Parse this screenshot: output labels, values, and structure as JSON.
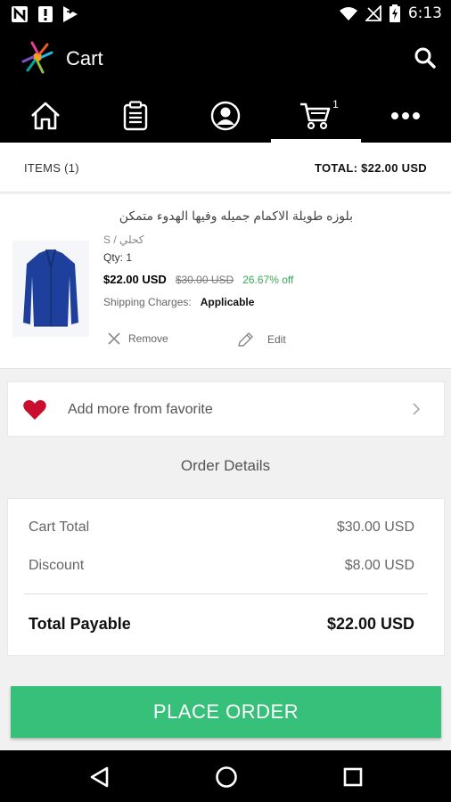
{
  "status_bar": {
    "time": "6:13",
    "icons": [
      "n-notification-icon",
      "alert-icon",
      "forward-icon",
      "wifi-icon",
      "no-signal-icon",
      "battery-charging-icon"
    ]
  },
  "app_bar": {
    "title": "Cart",
    "icons": [
      "app-logo",
      "search-icon"
    ]
  },
  "tabs": [
    {
      "name": "home",
      "icon": "home-icon"
    },
    {
      "name": "orders",
      "icon": "clipboard-icon"
    },
    {
      "name": "account",
      "icon": "user-icon"
    },
    {
      "name": "cart",
      "icon": "cart-icon",
      "badge": "1",
      "active": true
    },
    {
      "name": "more",
      "icon": "more-icon"
    }
  ],
  "cart_header": {
    "items": "ITEMS (1)",
    "total": "TOTAL: $22.00 USD"
  },
  "cart_item": {
    "name": "بلوزه طويلة الاكمام جميله وفيها الهدوء متمكن",
    "variant": "S / كحلي",
    "qty": "Qty: 1",
    "price": "$22.00 USD",
    "original_price": "$30.00 USD",
    "discount": "26.67% off",
    "shipping_label": "Shipping Charges:",
    "shipping_value": "Applicable",
    "remove_label": "Remove",
    "edit_label": "Edit"
  },
  "favorite": {
    "label": "Add more from favorite"
  },
  "order_details": {
    "heading": "Order Details",
    "cart_total_label": "Cart Total",
    "cart_total_value": "$30.00 USD",
    "discount_label": "Discount",
    "discount_value": "$8.00 USD",
    "payable_label": "Total Payable",
    "payable_value": "$22.00 USD"
  },
  "place_order": {
    "label": "PLACE ORDER"
  },
  "nav_bar": {
    "icons": [
      "back-icon",
      "home-circle-icon",
      "recents-icon"
    ]
  },
  "colors": {
    "accent_green": "#37c07a",
    "discount_green": "#3aa65b",
    "heart_red": "#c8102e",
    "bar_black": "#000000",
    "product_blue": "#1f3f9c"
  }
}
